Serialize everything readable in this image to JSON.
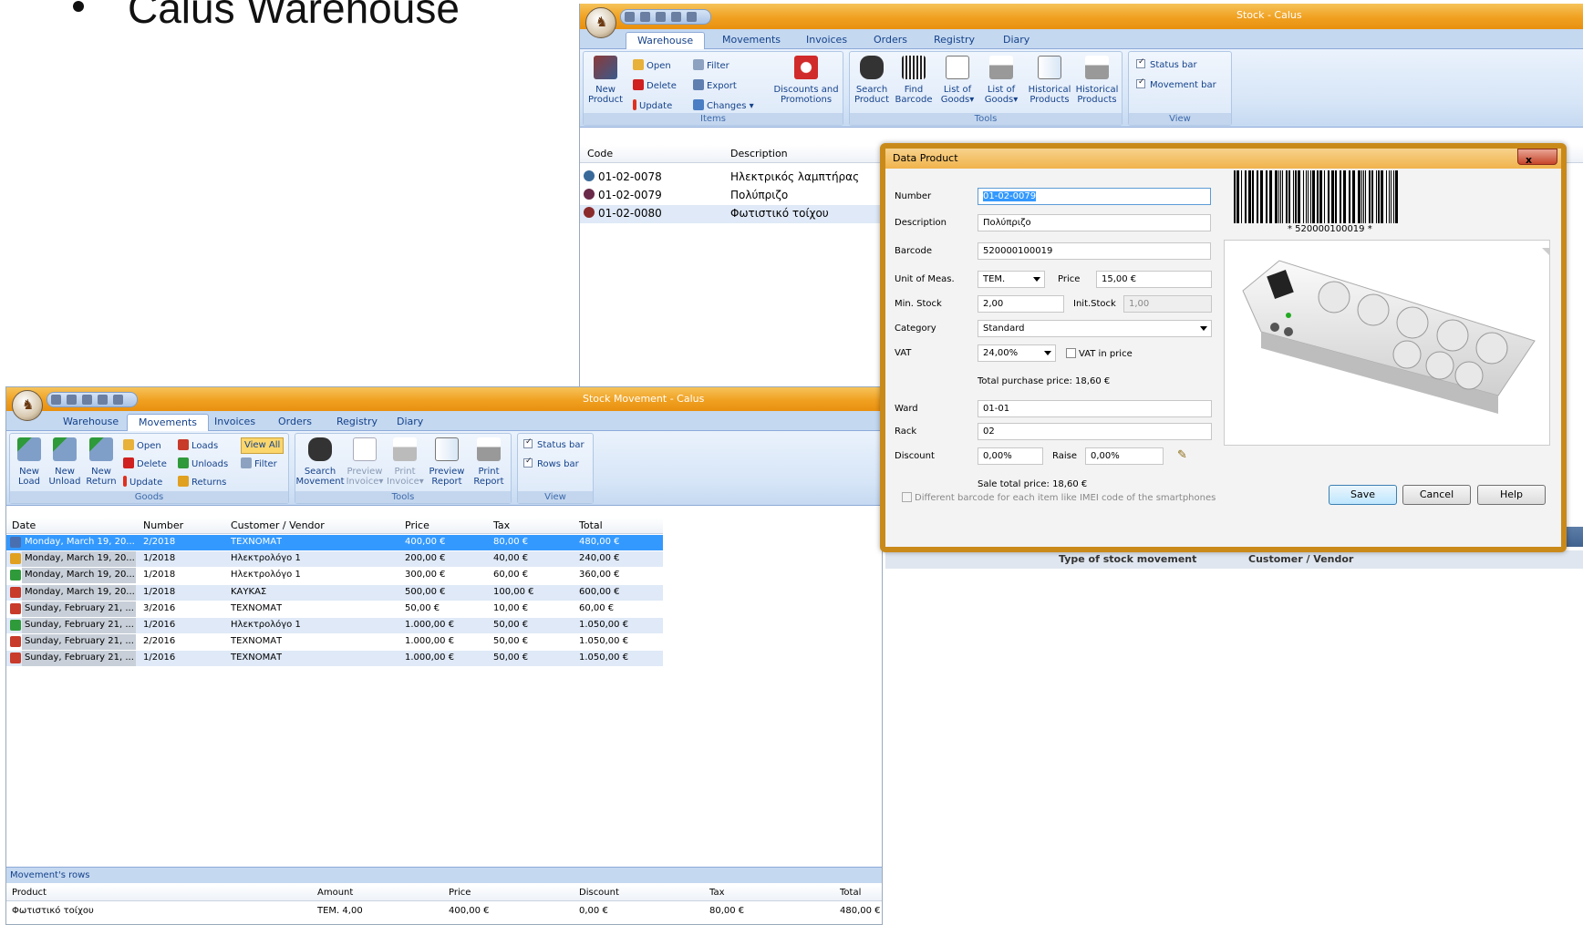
{
  "slide": {
    "title": "Calus Warehouse"
  },
  "stock_window": {
    "title": "Stock - Calus",
    "tabs": [
      "Warehouse",
      "Movements",
      "Invoices",
      "Orders",
      "Registry",
      "Diary"
    ],
    "ribbon": {
      "items": {
        "new_product": "New Product",
        "open": "Open",
        "delete": "Delete",
        "update": "Update",
        "filter": "Filter",
        "export": "Export",
        "changes": "Changes",
        "discounts": "Discounts and Promotions",
        "label": "Items"
      },
      "tools": {
        "search_product": "Search Product",
        "find_barcode": "Find Barcode",
        "list_goods_1": "List of Goods",
        "list_goods_2": "List of Goods",
        "historical_products_1": "Historical Products",
        "historical_products_2": "Historical Products",
        "label": "Tools"
      },
      "view": {
        "status_bar": "Status bar",
        "movement_bar": "Movement bar",
        "label": "View"
      }
    },
    "grid": {
      "columns": [
        "Code",
        "Description"
      ],
      "rows": [
        {
          "code": "01-02-0078",
          "description": "Ηλεκτρικός λαμπτήρας"
        },
        {
          "code": "01-02-0079",
          "description": "Πολύπριζο"
        },
        {
          "code": "01-02-0080",
          "description": "Φωτιστικό τοίχου"
        }
      ]
    },
    "lower_headers": [
      "Type of stock movement",
      "Customer / Vendor"
    ]
  },
  "movement_window": {
    "title": "Stock Movement - Calus",
    "tabs": [
      "Warehouse",
      "Movements",
      "Invoices",
      "Orders",
      "Registry",
      "Diary"
    ],
    "ribbon": {
      "goods": {
        "new_load": "New Load",
        "new_unload": "New Unload",
        "new_return": "New Return",
        "open": "Open",
        "delete": "Delete",
        "update": "Update",
        "loads": "Loads",
        "unloads": "Unloads",
        "returns": "Returns",
        "view_all": "View All",
        "filter": "Filter",
        "label": "Goods"
      },
      "tools": {
        "search_movement": "Search Movement",
        "preview_invoice": "Preview Invoice",
        "print_invoice": "Print Invoice",
        "preview_report": "Preview Report",
        "print_report": "Print Report",
        "label": "Tools"
      },
      "view": {
        "status_bar": "Status bar",
        "rows_bar": "Rows bar",
        "label": "View"
      }
    },
    "grid": {
      "columns": [
        "Date",
        "Number",
        "Customer / Vendor",
        "Price",
        "Tax",
        "Total"
      ],
      "rows": [
        {
          "date": "Monday, March 19, 20...",
          "number": "2/2018",
          "customer": "ΤΕΧΝΟΜΑΤ",
          "price": "400,00 €",
          "tax": "80,00 €",
          "total": "480,00 €",
          "icon_color": "#4a6fb0"
        },
        {
          "date": "Monday, March 19, 20...",
          "number": "1/2018",
          "customer": "Ηλεκτρολόγο 1",
          "price": "200,00 €",
          "tax": "40,00 €",
          "total": "240,00 €",
          "icon_color": "#e0a020"
        },
        {
          "date": "Monday, March 19, 20...",
          "number": "1/2018",
          "customer": "Ηλεκτρολόγο 1",
          "price": "300,00 €",
          "tax": "60,00 €",
          "total": "360,00 €",
          "icon_color": "#2f9a3a"
        },
        {
          "date": "Monday, March 19, 20...",
          "number": "1/2018",
          "customer": "ΚΑΥΚΑΣ",
          "price": "500,00 €",
          "tax": "100,00 €",
          "total": "600,00 €",
          "icon_color": "#c83a2a"
        },
        {
          "date": "Sunday, February 21, ...",
          "number": "3/2016",
          "customer": "ΤΕΧΝΟΜΑΤ",
          "price": "50,00 €",
          "tax": "10,00 €",
          "total": "60,00 €",
          "icon_color": "#c83a2a"
        },
        {
          "date": "Sunday, February 21, ...",
          "number": "1/2016",
          "customer": "Ηλεκτρολόγο 1",
          "price": "1.000,00 €",
          "tax": "50,00 €",
          "total": "1.050,00 €",
          "icon_color": "#2f9a3a"
        },
        {
          "date": "Sunday, February 21, ...",
          "number": "2/2016",
          "customer": "ΤΕΧΝΟΜΑΤ",
          "price": "1.000,00 €",
          "tax": "50,00 €",
          "total": "1.050,00 €",
          "icon_color": "#c83a2a"
        },
        {
          "date": "Sunday, February 21, ...",
          "number": "1/2016",
          "customer": "ΤΕΧΝΟΜΑΤ",
          "price": "1.000,00 €",
          "tax": "50,00 €",
          "total": "1.050,00 €",
          "icon_color": "#c83a2a"
        }
      ]
    },
    "rows_panel": {
      "title": "Movement's rows",
      "columns": [
        "Product",
        "Amount",
        "Price",
        "Discount",
        "Tax",
        "Total"
      ],
      "row": {
        "product": "Φωτιστικό τοίχου",
        "amount": "TEM. 4,00",
        "price": "400,00 €",
        "discount": "0,00 €",
        "tax": "80,00 €",
        "total": "480,00 €"
      }
    }
  },
  "dialog": {
    "title": "Data Product",
    "close": "x",
    "number_label": "Number",
    "number": "01-02-0079",
    "description_label": "Description",
    "description": "Πολύπριζο",
    "barcode_label": "Barcode",
    "barcode": "520000100019",
    "barcode_caption": "* 520000100019 *",
    "unit_label": "Unit of Meas.",
    "unit": "TEM.",
    "price_label": "Price",
    "price": "15,00 €",
    "min_stock_label": "Min. Stock",
    "min_stock": "2,00",
    "init_stock_label": "Init.Stock",
    "init_stock": "1,00",
    "category_label": "Category",
    "category": "Standard",
    "vat_label": "VAT",
    "vat": "24,00%",
    "vat_in_price": "VAT in price",
    "total_purchase": "Total purchase price: 18,60 €",
    "ward_label": "Ward",
    "ward": "01-01",
    "rack_label": "Rack",
    "rack": "02",
    "discount_label": "Discount",
    "discount": "0,00%",
    "raise_label": "Raise",
    "raise": "0,00%",
    "sale_total": "Sale total price: 18,60 €",
    "imei_checkbox": "Different barcode for each item like IMEI code of the smartphones",
    "save": "Save",
    "cancel": "Cancel",
    "help": "Help"
  }
}
